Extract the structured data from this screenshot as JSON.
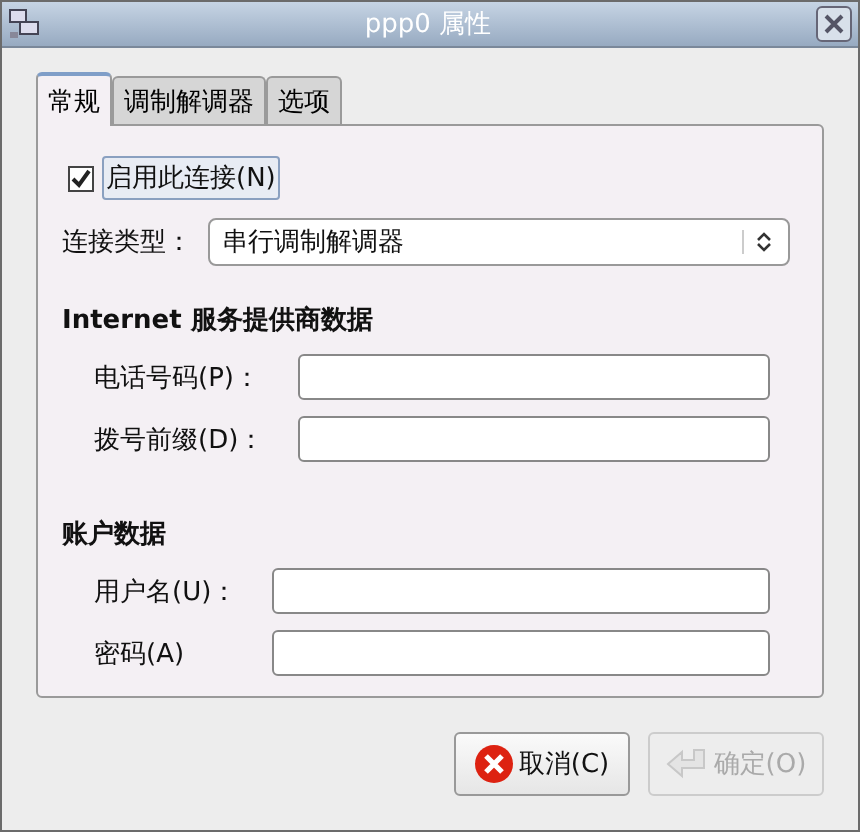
{
  "window": {
    "title": "ppp0 属性"
  },
  "tabs": [
    {
      "label": "常规",
      "selected": true
    },
    {
      "label": "调制解调器",
      "selected": false
    },
    {
      "label": "选项",
      "selected": false
    }
  ],
  "enable": {
    "label": "启用此连接(N)",
    "checked": true
  },
  "connection_type": {
    "label": "连接类型：",
    "value": "串行调制解调器"
  },
  "sections": [
    {
      "title": "Internet 服务提供商数据",
      "fields": [
        {
          "label": "电话号码(P)："
        },
        {
          "label": "拨号前缀(D)："
        }
      ]
    },
    {
      "title": "账户数据",
      "fields": [
        {
          "label": "用户名(U)："
        },
        {
          "label": "密码(A)"
        }
      ]
    }
  ],
  "buttons": [
    {
      "label": "取消(C)",
      "kind": "cancel",
      "disabled": false
    },
    {
      "label": "确定(O)",
      "kind": "ok",
      "disabled": true
    }
  ]
}
